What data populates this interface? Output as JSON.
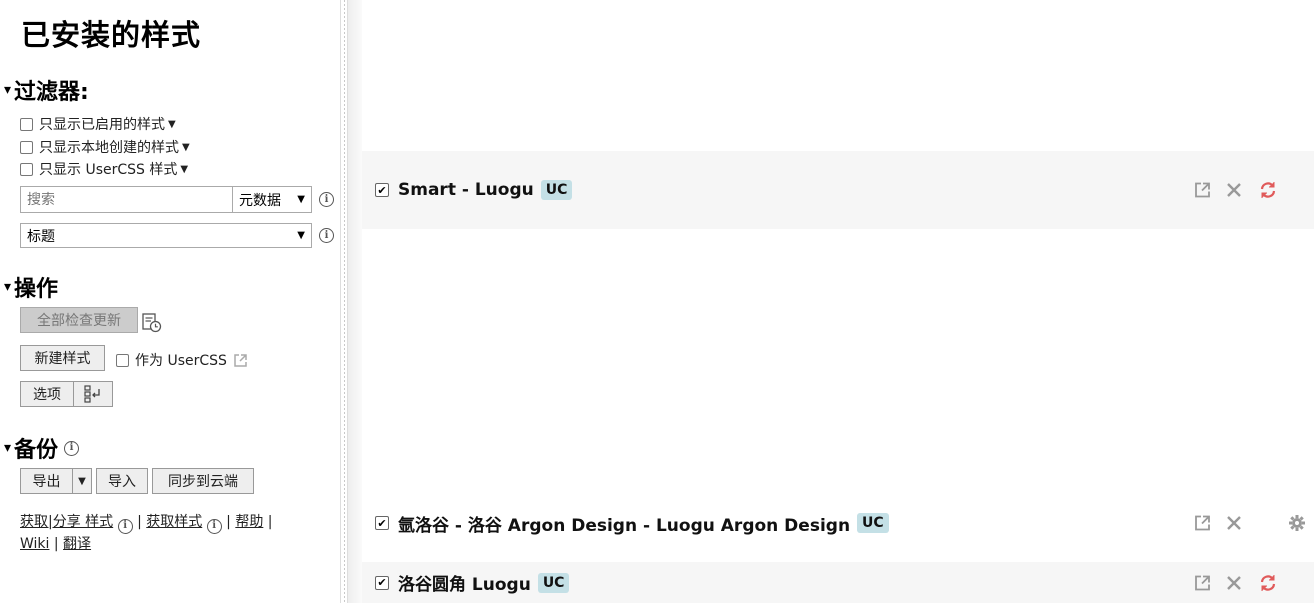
{
  "sidebar": {
    "title": "已安装的样式",
    "filters": {
      "heading": "过滤器:",
      "enabled_only": "只显示已启用的样式",
      "local_only": "只显示本地创建的样式",
      "usercss_only": "只显示 UserCSS 样式",
      "search_placeholder": "搜索",
      "search_value": "",
      "search_scope": "元数据",
      "sort_value": "标题"
    },
    "actions": {
      "heading": "操作",
      "check_updates": "全部检查更新",
      "new_style": "新建样式",
      "as_usercss": "作为 UserCSS",
      "options": "选项"
    },
    "backup": {
      "heading": "备份",
      "export": "导出",
      "import": "导入",
      "sync": "同步到云端"
    },
    "links": {
      "get_share": "获取|分享 样式",
      "get_styles": "获取样式",
      "help": "帮助",
      "wiki": "Wiki",
      "translate": "翻译",
      "sep": "|"
    }
  },
  "styles": [
    {
      "name": "Smart - Luogu",
      "badge": "UC",
      "enabled": true,
      "action": "update"
    },
    {
      "name": "氩洛谷 - 洛谷 Argon Design - Luogu Argon Design",
      "badge": "UC",
      "enabled": true,
      "action": "configure"
    },
    {
      "name": "洛谷圆角 Luogu",
      "badge": "UC",
      "enabled": true,
      "action": "update"
    }
  ],
  "colors": {
    "badge_bg": "#c4e0e6",
    "update_icon": "#e05a5a",
    "stripe": "#f6f6f6"
  }
}
